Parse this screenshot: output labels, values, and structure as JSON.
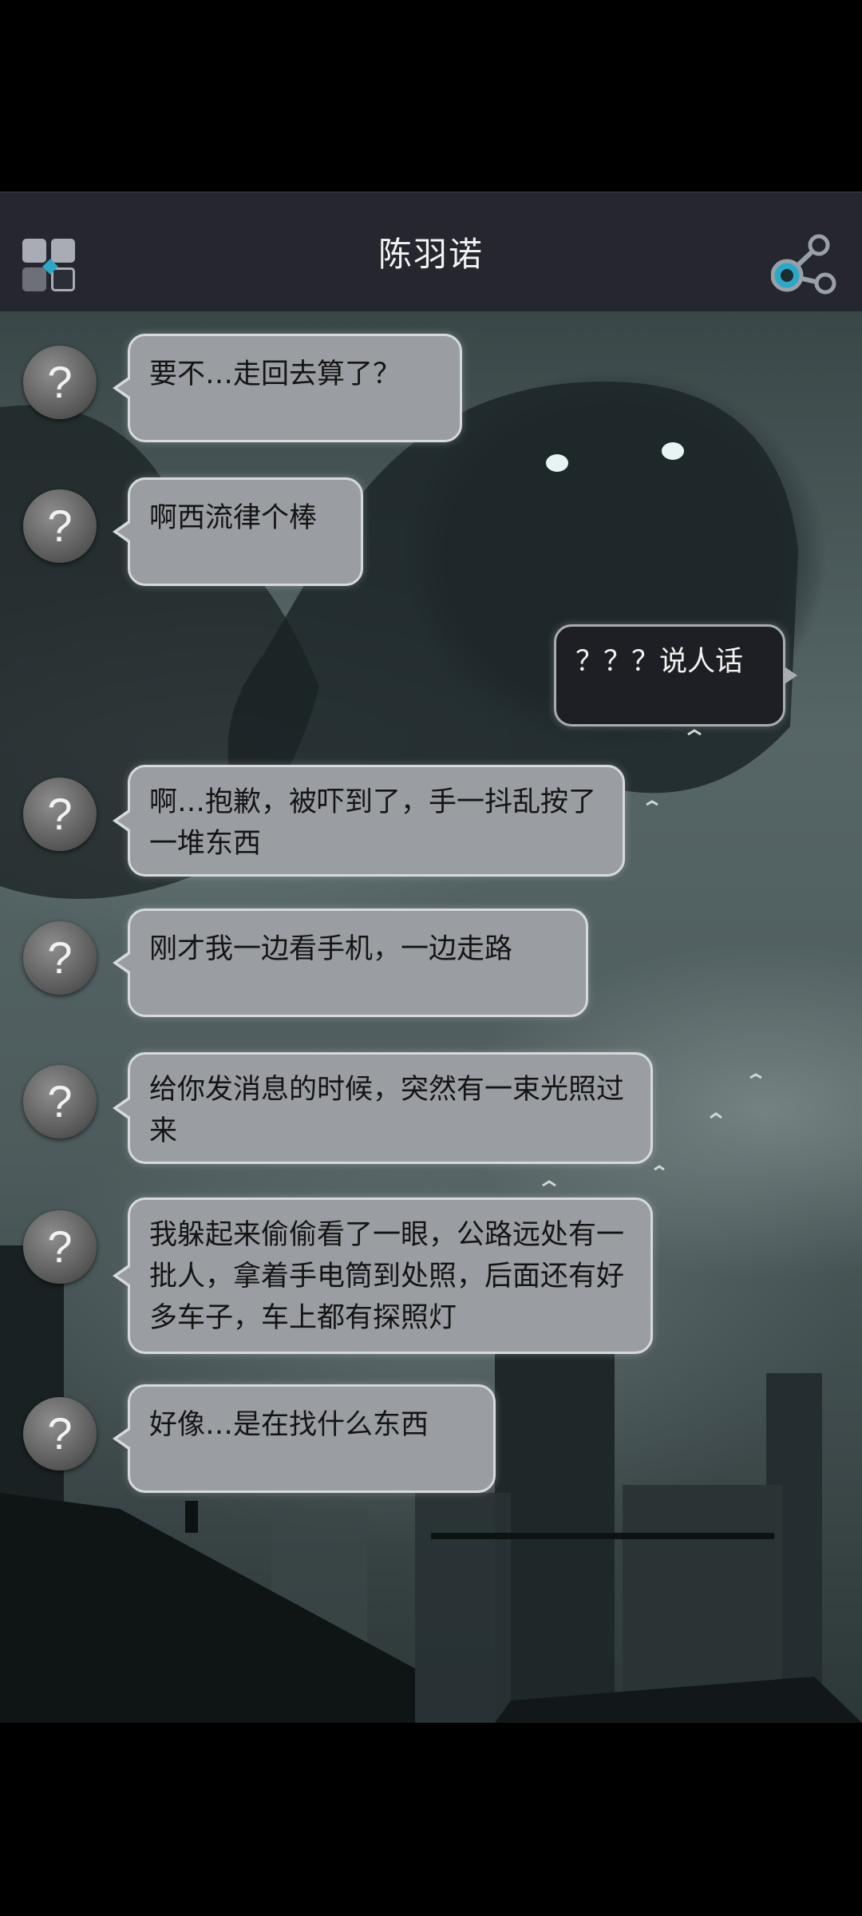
{
  "header": {
    "title": "陈羽诺",
    "menu_icon": "grid-menu-icon",
    "share_icon": "share-icon"
  },
  "messages": [
    {
      "side": "in",
      "avatar": "?",
      "text": "要不…走回去算了？"
    },
    {
      "side": "in",
      "avatar": "?",
      "text": "啊西流律个棒"
    },
    {
      "side": "out",
      "text": "？？？说人话"
    },
    {
      "side": "in",
      "avatar": "?",
      "text": "啊…抱歉，被吓到了，手一抖乱按了一堆东西"
    },
    {
      "side": "in",
      "avatar": "?",
      "text": "刚才我一边看手机，一边走路"
    },
    {
      "side": "in",
      "avatar": "?",
      "text": "给你发消息的时候，突然有一束光照过来"
    },
    {
      "side": "in",
      "avatar": "?",
      "text": "我躲起来偷偷看了一眼，公路远处有一批人，拿着手电筒到处照，后面还有好多车子，车上都有探照灯"
    },
    {
      "side": "in",
      "avatar": "?",
      "text": "好像…是在找什么东西"
    }
  ],
  "colors": {
    "header_bg": "#25262e",
    "bubble_in": "#9a9ea3",
    "bubble_out": "#1e1f25"
  }
}
